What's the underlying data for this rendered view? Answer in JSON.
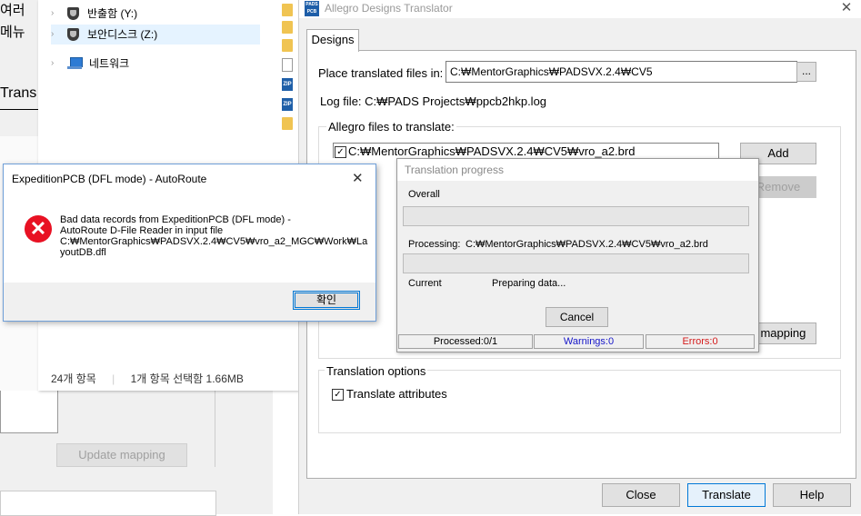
{
  "background_app": {
    "label_top": "여러",
    "label_menu": "메뉴",
    "label_trans": "Trans",
    "update_mapping_label": "Update mapping"
  },
  "explorer": {
    "tree": [
      {
        "label": "반출함 (Y:)",
        "icon": "shield-drive-icon"
      },
      {
        "label": "보안디스크 (Z:)",
        "icon": "shield-drive-icon",
        "selected": true
      },
      {
        "label": "네트워크",
        "icon": "network-icon"
      }
    ],
    "status_count": "24개 항목",
    "status_selected": "1개 항목 선택함 1.66MB",
    "zip_label": "ZIP"
  },
  "allegro": {
    "app_icon_text": "PADS\nPCB",
    "title": "Allegro Designs Translator",
    "close_glyph": "✕",
    "tab_label": "Designs",
    "place_label": "Place translated files in:",
    "place_value": "C:₩MentorGraphics₩PADSVX.2.4₩CV5",
    "browse_label": "...",
    "logfile": "Log file:  C:₩PADS Projects₩ppcb2hkp.log",
    "files_group_label": "Allegro files to translate:",
    "file_item": "C:₩MentorGraphics₩PADSVX.2.4₩CV5₩vro_a2.brd",
    "file_checked": true,
    "add_label": "Add",
    "remove_label": "Remove",
    "mapping_label": "e mapping",
    "options_group_label": "Translation options",
    "translate_attributes_label": "Translate attributes",
    "translate_attributes_checked": true,
    "close_label": "Close",
    "translate_label": "Translate",
    "help_label": "Help"
  },
  "progress": {
    "title": "Translation progress",
    "overall_label": "Overall",
    "overall_fraction": 0,
    "processing_label": "Processing:",
    "processing_value": "C:₩MentorGraphics₩PADSVX.2.4₩CV5₩vro_a2.brd",
    "processing_fraction": 0,
    "current_label": "Current",
    "current_value": "Preparing data...",
    "cancel_label": "Cancel",
    "processed": "Processed:0/1",
    "warnings": "Warnings:0",
    "errors": "Errors:0"
  },
  "error_dialog": {
    "title": "ExpeditionPCB (DFL mode) - AutoRoute",
    "close_glyph": "✕",
    "message_lines": [
      "Bad data records from ExpeditionPCB (DFL mode) -",
      "AutoRoute D-File Reader in input file",
      "C:₩MentorGraphics₩PADSVX.2.4₩CV5₩vro_a2_MGC₩Work₩La",
      "youtDB.dfl"
    ],
    "ok_label": "확인"
  },
  "colors": {
    "accent": "#0078d7",
    "error_red": "#e81123",
    "warnings_blue": "#1515c8",
    "errors_red": "#d41a1a"
  }
}
